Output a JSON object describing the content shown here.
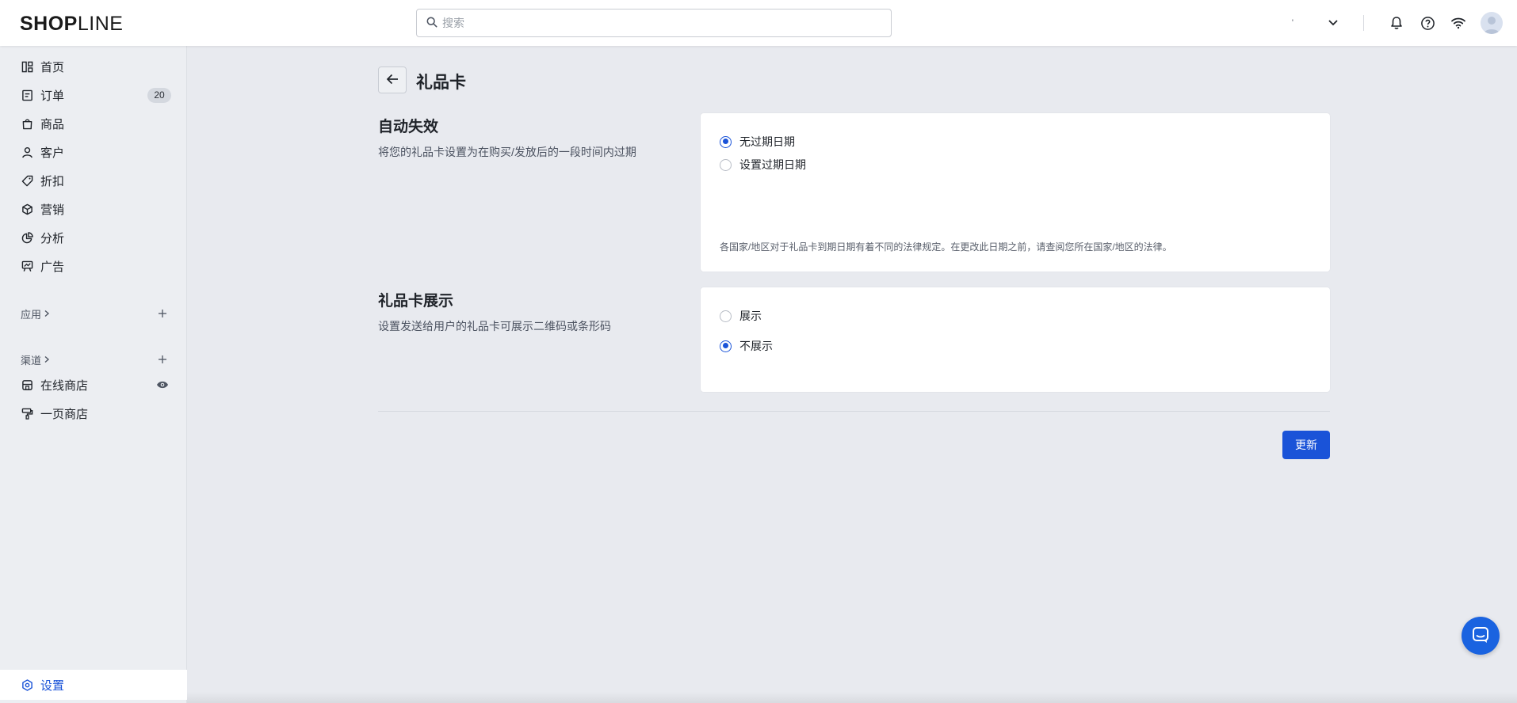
{
  "topbar": {
    "logo_shop": "SHOP",
    "logo_line": "LINE",
    "search_placeholder": "搜索",
    "store_name": "'"
  },
  "sidebar": {
    "items": [
      {
        "label": "首页",
        "icon": "home-grid-icon"
      },
      {
        "label": "订单",
        "icon": "order-icon",
        "badge": "20"
      },
      {
        "label": "商品",
        "icon": "bag-icon"
      },
      {
        "label": "客户",
        "icon": "person-icon"
      },
      {
        "label": "折扣",
        "icon": "tag-icon"
      },
      {
        "label": "营销",
        "icon": "cube-icon"
      },
      {
        "label": "分析",
        "icon": "pie-chart-icon"
      },
      {
        "label": "广告",
        "icon": "ad-board-icon"
      }
    ],
    "apps_label": "应用",
    "channels_label": "渠道",
    "channels": [
      {
        "label": "在线商店",
        "icon": "store-icon"
      },
      {
        "label": "一页商店",
        "icon": "paint-roller-icon"
      }
    ],
    "settings_label": "设置"
  },
  "main": {
    "page_title": "礼品卡",
    "auto_expire": {
      "title": "自动失效",
      "description": "将您的礼品卡设置为在购买/发放后的一段时间内过期",
      "options": [
        {
          "label": "无过期日期",
          "checked": true
        },
        {
          "label": "设置过期日期",
          "checked": false
        }
      ],
      "note": "各国家/地区对于礼品卡到期日期有着不同的法律规定。在更改此日期之前，请查阅您所在国家/地区的法律。"
    },
    "display": {
      "title": "礼品卡展示",
      "description": "设置发送给用户的礼品卡可展示二维码或条形码",
      "options": [
        {
          "label": "展示",
          "checked": false
        },
        {
          "label": "不展示",
          "checked": true
        }
      ]
    },
    "update_label": "更新"
  },
  "colors": {
    "accent": "#1a53d8",
    "background": "#e8eaef",
    "card": "#ffffff"
  }
}
